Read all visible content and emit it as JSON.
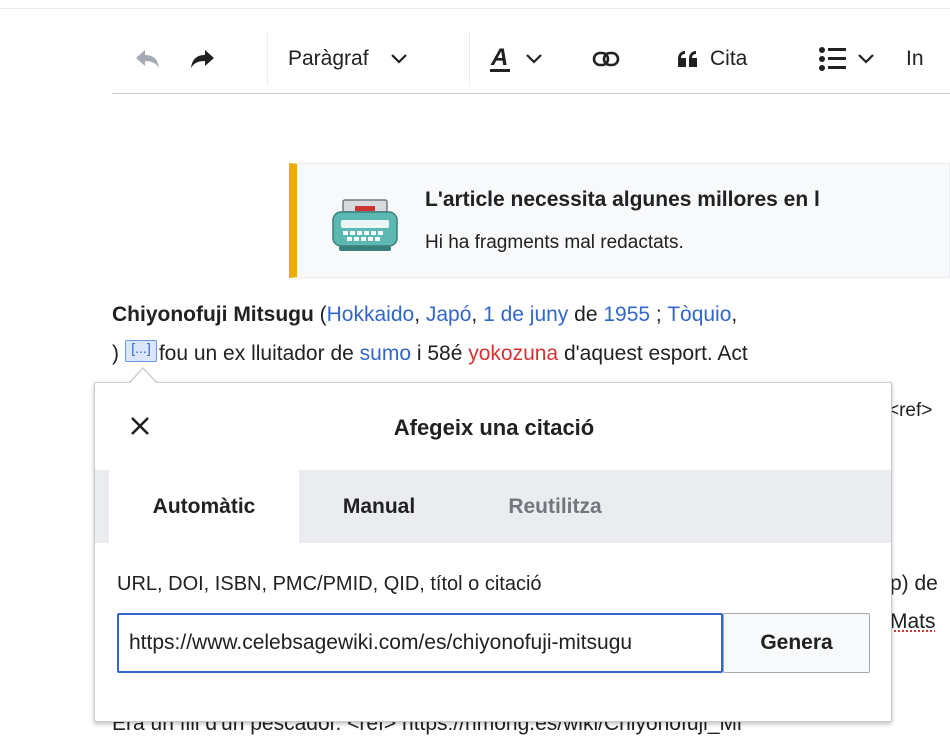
{
  "toolbar": {
    "undo_icon": "undo-icon",
    "redo_icon": "redo-icon",
    "paragraph_label": "Paràgraf",
    "text_style_icon": "text-style-icon",
    "link_icon": "link-icon",
    "cite_label": "Cita",
    "list_icon": "list-icon",
    "insert_label_partial": "In"
  },
  "notice": {
    "icon": "typewriter-icon",
    "title": "L'article necessita algunes millores en l",
    "subtitle": "Hi ha fragments mal redactats.",
    "accent": "#edab00"
  },
  "article": {
    "line1": {
      "name": "Chiyonofuji Mitsugu",
      "open": " (",
      "l1": "Hokkaido",
      "s1": ", ",
      "l2": "Japó",
      "s2": ", ",
      "l3": "1 de juny",
      "s3": " de ",
      "l4": "1955",
      "s4": " ; ",
      "l5": "Tòquio",
      "s5": ","
    },
    "line2": {
      "close": ")",
      "ref_marker": "[...]",
      "t1": " fou un ex lluitador de ",
      "l1": "sumo",
      "t2": " i 58é ",
      "r1": "yokozuna",
      "t3": " d'aquest esport. Act"
    },
    "bg_ref_fragment": "<ref>",
    "bg_fragment_2": "p) de",
    "bg_fragment_3": "Mats",
    "last_line": "Era un fill d'un pescador. <ref> https://hmong.es/wiki/Chiyonofuji_Mi"
  },
  "dialog": {
    "title": "Afegeix una citació",
    "close_icon": "close-icon",
    "tabs": [
      "Automàtic",
      "Manual",
      "Reutilitza"
    ],
    "active_tab": "Automàtic",
    "input_label": "URL, DOI, ISBN, PMC/PMID, QID, títol o citació",
    "input_value": "https://www.celebsagewiki.com/es/chiyonofuji-mitsugu",
    "generate_label": "Genera"
  },
  "colors": {
    "link": "#3366cc",
    "redlink": "#d73333",
    "focus": "#3366cc"
  }
}
